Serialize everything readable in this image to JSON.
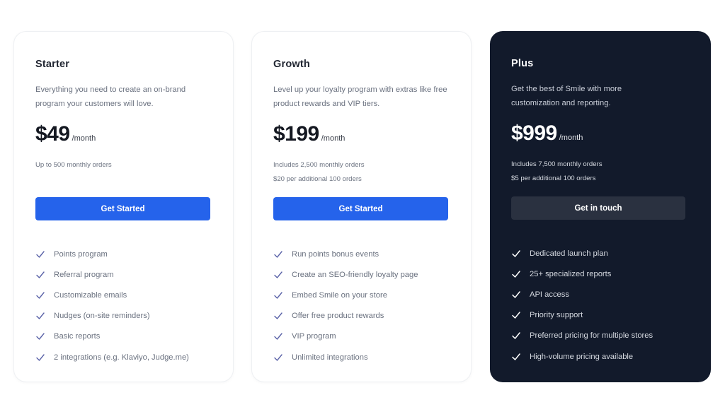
{
  "plans": [
    {
      "name": "Starter",
      "description": "Everything you need to create an on-brand program your customers will love.",
      "price": "$49",
      "period": "/month",
      "notes": [
        "Up to 500 monthly orders"
      ],
      "cta": "Get Started",
      "features": [
        "Points program",
        "Referral program",
        "Customizable emails",
        "Nudges (on-site reminders)",
        "Basic reports",
        "2 integrations (e.g. Klaviyo, Judge.me)"
      ]
    },
    {
      "name": "Growth",
      "description": "Level up your loyalty program with extras like free product rewards and VIP tiers.",
      "price": "$199",
      "period": "/month",
      "notes": [
        "Includes 2,500 monthly orders",
        "$20 per additional 100 orders"
      ],
      "cta": "Get Started",
      "features": [
        "Run points bonus events",
        "Create an SEO-friendly loyalty page",
        "Embed Smile on your store",
        "Offer free product rewards",
        "VIP program",
        "Unlimited integrations"
      ]
    },
    {
      "name": "Plus",
      "description": "Get the best of Smile with more customization and reporting.",
      "price": "$999",
      "period": "/month",
      "notes": [
        "Includes 7,500 monthly orders",
        "$5 per additional 100 orders"
      ],
      "cta": "Get in touch",
      "features": [
        "Dedicated launch plan",
        "25+ specialized reports",
        "API access",
        "Priority support",
        "Preferred pricing for multiple stores",
        "High-volume pricing available"
      ]
    }
  ],
  "icons": {
    "feature_bullet": "check-icon"
  },
  "colors": {
    "primary_button": "#2563eb",
    "dark_card": "#121a2b",
    "dark_button": "#2a3140",
    "check_light": "#5b63a8",
    "check_dark": "#ffffff"
  }
}
